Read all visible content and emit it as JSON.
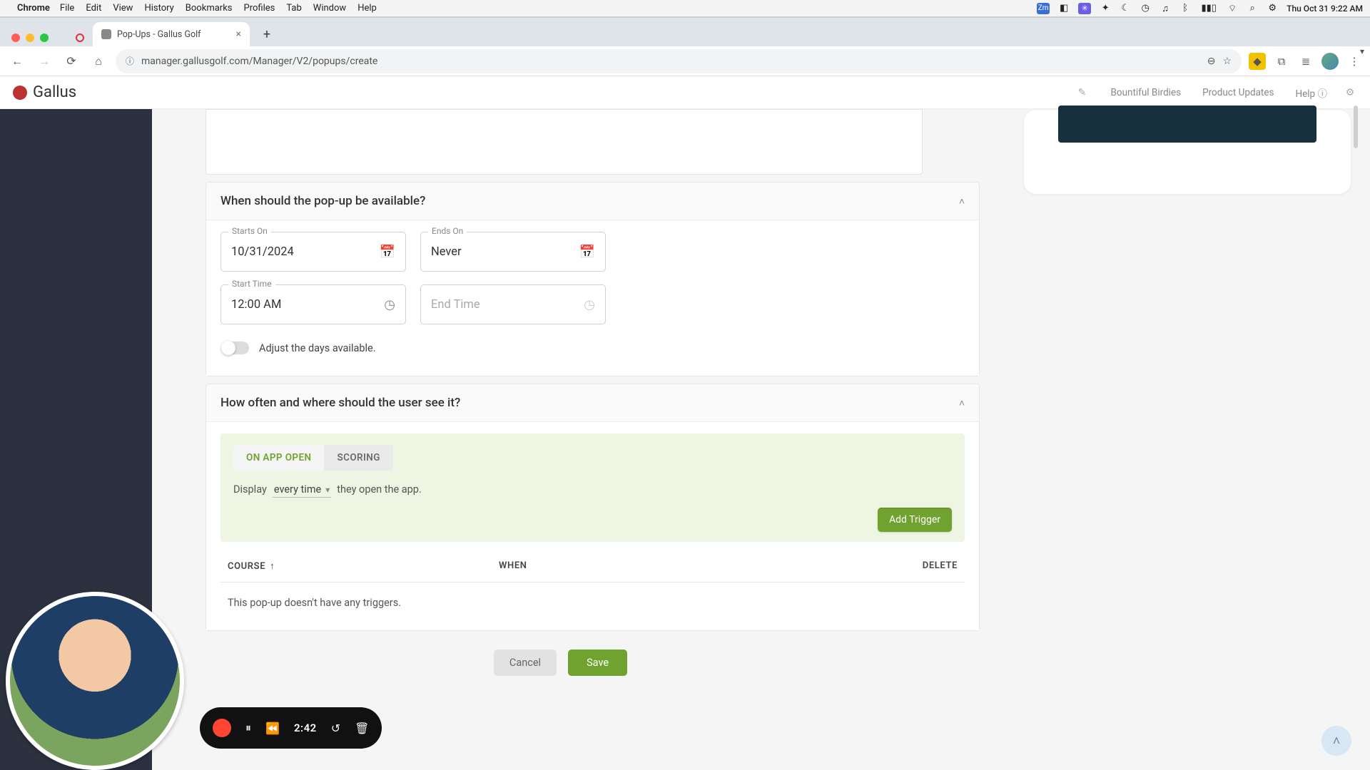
{
  "mac": {
    "browser_name": "Chrome",
    "menus": [
      "File",
      "Edit",
      "View",
      "History",
      "Bookmarks",
      "Profiles",
      "Tab",
      "Window",
      "Help"
    ],
    "clock": "Thu Oct 31  9:22 AM"
  },
  "chrome": {
    "tab_title": "Pop-Ups - Gallus Golf",
    "url": "manager.gallusgolf.com/Manager/V2/popups/create"
  },
  "header": {
    "brand": "Gallus",
    "links": {
      "org": "Bountiful Birdies",
      "updates": "Product Updates",
      "help": "Help"
    }
  },
  "sections": {
    "availability": {
      "title": "When should the pop-up be available?",
      "starts_on_label": "Starts On",
      "starts_on_value": "10/31/2024",
      "ends_on_label": "Ends On",
      "ends_on_value": "Never",
      "start_time_label": "Start Time",
      "start_time_value": "12:00 AM",
      "end_time_placeholder": "End Time",
      "adjust_days_label": "Adjust the days available."
    },
    "frequency": {
      "title": "How often and where should the user see it?",
      "tab_app_open": "ON APP OPEN",
      "tab_scoring": "SCORING",
      "display_prefix": "Display",
      "display_select": "every time",
      "display_suffix": "they open the app.",
      "add_trigger": "Add Trigger",
      "table": {
        "course": "COURSE",
        "when": "WHEN",
        "delete": "DELETE",
        "empty": "This pop-up doesn't have any triggers."
      }
    }
  },
  "actions": {
    "cancel": "Cancel",
    "save": "Save"
  },
  "loom": {
    "time": "2:42"
  }
}
